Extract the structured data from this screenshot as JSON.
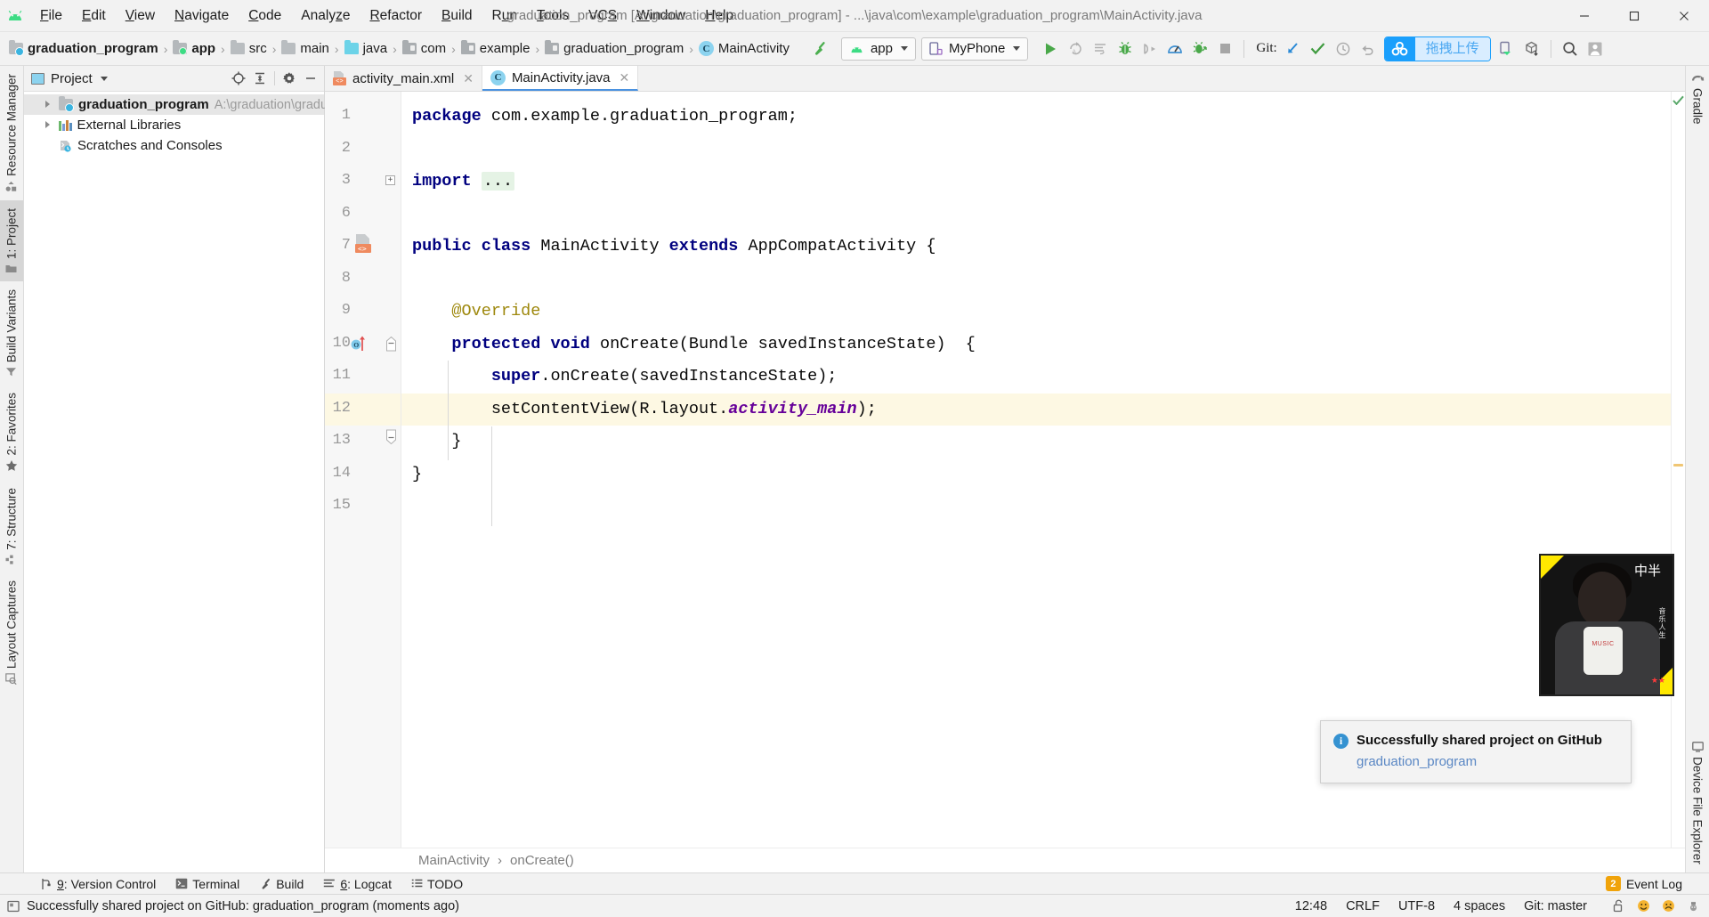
{
  "window": {
    "title": "graduation_program [A:\\graduation\\graduation_program] - ...\\java\\com\\example\\graduation_program\\MainActivity.java",
    "minimize_label": "–",
    "maximize_label": "❐",
    "close_label": "✕",
    "app_icon": "android-logo-icon"
  },
  "menubar": [
    {
      "label": "File",
      "mnemonic": "F"
    },
    {
      "label": "Edit",
      "mnemonic": "E"
    },
    {
      "label": "View",
      "mnemonic": "V"
    },
    {
      "label": "Navigate",
      "mnemonic": "N"
    },
    {
      "label": "Code",
      "mnemonic": "C"
    },
    {
      "label": "Analyze",
      "mnemonic": "z"
    },
    {
      "label": "Refactor",
      "mnemonic": "R"
    },
    {
      "label": "Build",
      "mnemonic": "B"
    },
    {
      "label": "Run",
      "mnemonic": "u"
    },
    {
      "label": "Tools",
      "mnemonic": "T"
    },
    {
      "label": "VCS",
      "mnemonic": "S"
    },
    {
      "label": "Window",
      "mnemonic": "W"
    },
    {
      "label": "Help",
      "mnemonic": "H"
    }
  ],
  "breadcrumb_bar": {
    "items": [
      {
        "label": "graduation_program",
        "icon": "project-folder-icon",
        "bold": true
      },
      {
        "label": "app",
        "icon": "module-icon",
        "bold": true
      },
      {
        "label": "src",
        "icon": "folder-icon",
        "bold": false
      },
      {
        "label": "main",
        "icon": "folder-icon",
        "bold": false
      },
      {
        "label": "java",
        "icon": "java-folder-icon",
        "bold": false
      },
      {
        "label": "com",
        "icon": "package-icon",
        "bold": false
      },
      {
        "label": "example",
        "icon": "package-icon",
        "bold": false
      },
      {
        "label": "graduation_program",
        "icon": "package-icon",
        "bold": false
      },
      {
        "label": "MainActivity",
        "icon": "class-icon",
        "bold": false
      }
    ],
    "separator": "›"
  },
  "toolbar": {
    "build_icon": "hammer-icon",
    "run_config": {
      "label": "app",
      "icon": "android-icon"
    },
    "device": {
      "label": "MyPhone",
      "icon": "phone-icon"
    },
    "actions": [
      {
        "name": "run-button",
        "icon": "play-icon",
        "color": "#49a849"
      },
      {
        "name": "apply-changes-button",
        "icon": "apply-changes-icon",
        "color": "#b0b0b0"
      },
      {
        "name": "apply-code-changes-button",
        "icon": "code-changes-icon",
        "color": "#b0b0b0"
      },
      {
        "name": "debug-button",
        "icon": "bug-icon",
        "color": "#49a849"
      },
      {
        "name": "attach-debugger-button",
        "icon": "attach-debugger-icon",
        "color": "#b0b0b0"
      },
      {
        "name": "profiler-button",
        "icon": "profiler-icon",
        "color": "#3d8fd1"
      },
      {
        "name": "run-with-coverage-button",
        "icon": "coverage-icon",
        "color": "#49a849"
      },
      {
        "name": "stop-button",
        "icon": "stop-icon",
        "color": "#a6a6a6"
      }
    ],
    "git_label": "Git:",
    "git_actions": [
      {
        "name": "update-project-button",
        "icon": "update-arrow-icon",
        "color": "#2b8ad6"
      },
      {
        "name": "commit-button",
        "icon": "checkmark-icon",
        "color": "#3f9b3f"
      },
      {
        "name": "history-button",
        "icon": "clock-icon",
        "color": "#9b9b9b"
      },
      {
        "name": "rollback-button",
        "icon": "undo-icon",
        "color": "#9b9b9b"
      }
    ],
    "upload_badge": {
      "text": "拖拽上传",
      "icon": "cloud-upload-icon",
      "accent": "#1a9ffc"
    },
    "right_actions": [
      {
        "name": "device-manager-button",
        "icon": "device-manager-icon"
      },
      {
        "name": "sdk-manager-button",
        "icon": "sdk-box-icon"
      },
      {
        "name": "search-everywhere-button",
        "icon": "search-icon"
      },
      {
        "name": "account-button",
        "icon": "avatar-icon"
      }
    ]
  },
  "left_tool_strip": [
    {
      "label": "Resource Manager",
      "icon": "resource-manager-icon",
      "active": false
    },
    {
      "label": "1: Project",
      "icon": "project-icon",
      "active": true
    },
    {
      "label": "Build Variants",
      "icon": "build-variants-icon",
      "active": false
    },
    {
      "label": "2: Favorites",
      "icon": "star-icon",
      "active": false
    },
    {
      "label": "7: Structure",
      "icon": "structure-icon",
      "active": false
    },
    {
      "label": "Layout Captures",
      "icon": "layout-captures-icon",
      "active": false
    }
  ],
  "right_tool_strip": [
    {
      "label": "Gradle",
      "icon": "gradle-elephant-icon"
    },
    {
      "label": "Device File Explorer",
      "icon": "device-file-explorer-icon"
    }
  ],
  "project_panel": {
    "title": "Project",
    "header_actions": [
      {
        "name": "scroll-from-source-button",
        "icon": "target-icon"
      },
      {
        "name": "collapse-all-button",
        "icon": "collapse-all-icon"
      },
      {
        "name": "settings-button",
        "icon": "gear-icon"
      },
      {
        "name": "hide-button",
        "icon": "minimize-icon"
      }
    ],
    "tree": [
      {
        "label": "graduation_program",
        "path": "A:\\graduation\\graduation_pr",
        "icon": "project-folder-icon",
        "expandable": true,
        "selected": true,
        "indent": 0
      },
      {
        "label": "External Libraries",
        "path": "",
        "icon": "libraries-icon",
        "expandable": true,
        "selected": false,
        "indent": 0
      },
      {
        "label": "Scratches and Consoles",
        "path": "",
        "icon": "scratches-icon",
        "expandable": false,
        "selected": false,
        "indent": 0
      }
    ]
  },
  "editor": {
    "tabs": [
      {
        "label": "activity_main.xml",
        "icon": "xml-layout-icon",
        "active": false,
        "close": "✕"
      },
      {
        "label": "MainActivity.java",
        "icon": "class-icon",
        "active": true,
        "close": "✕"
      }
    ],
    "highlighted_line": 12,
    "lines": [
      {
        "num": "1",
        "html": "<span class='kw'>package</span> com.example.graduation_program;"
      },
      {
        "num": "2",
        "html": ""
      },
      {
        "num": "3",
        "html": "<span class='kw'>import</span> <span class='fold-chip'>...</span>"
      },
      {
        "num": "6",
        "html": ""
      },
      {
        "num": "7",
        "html": "<span class='kw'>public class</span> MainActivity <span class='kw'>extends</span> AppCompatActivity {"
      },
      {
        "num": "8",
        "html": ""
      },
      {
        "num": "9",
        "html": "    <span class='anno'>@Override</span>"
      },
      {
        "num": "10",
        "html": "    <span class='kw'>protected void</span> onCreate(Bundle savedInstanceState)  {"
      },
      {
        "num": "11",
        "html": "        <span class='kw'>super</span>.onCreate(savedInstanceState);"
      },
      {
        "num": "12",
        "html": "        setContentView(R.layout.<span class='fld'>activity_main</span>);"
      },
      {
        "num": "13",
        "html": "    }"
      },
      {
        "num": "14",
        "html": "}"
      },
      {
        "num": "15",
        "html": ""
      }
    ],
    "breadcrumbs": [
      "MainActivity",
      "onCreate()"
    ],
    "breadcrumb_separator": "›"
  },
  "notification": {
    "title": "Successfully shared project on GitHub",
    "link": "graduation_program",
    "icon": "info-icon"
  },
  "bottom_tool_bar": {
    "items": [
      {
        "label": "9: Version Control",
        "icon": "version-control-icon"
      },
      {
        "label": "Terminal",
        "icon": "terminal-icon"
      },
      {
        "label": "Build",
        "icon": "hammer-icon"
      },
      {
        "label": "6: Logcat",
        "icon": "logcat-icon"
      },
      {
        "label": "TODO",
        "icon": "todo-icon"
      }
    ],
    "event_log": {
      "label": "Event Log",
      "count": "2"
    }
  },
  "status_bar": {
    "message": "Successfully shared project on GitHub: graduation_program (moments ago)",
    "message_icon": "message-icon",
    "time": "12:48",
    "line_separator": "CRLF",
    "encoding": "UTF-8",
    "indent": "4 spaces",
    "branch": "Git: master",
    "icons": [
      {
        "name": "lock-icon",
        "glyph": "🔓"
      },
      {
        "name": "happy-face-icon",
        "glyph": "🙂"
      },
      {
        "name": "sad-face-icon",
        "glyph": "🙁"
      },
      {
        "name": "hector-icon",
        "glyph": "🎩"
      }
    ]
  },
  "overlay_image": {
    "caption_top": "中半",
    "caption_side": "音乐人生",
    "shirt_text": "MUSIC",
    "stars": "★★"
  },
  "colors": {
    "accent_blue": "#1a9ffc",
    "green": "#3ddc84",
    "highlight_line": "#fdf8e3",
    "keyword": "#00007f",
    "annotation": "#9e880d",
    "field": "#660099"
  }
}
